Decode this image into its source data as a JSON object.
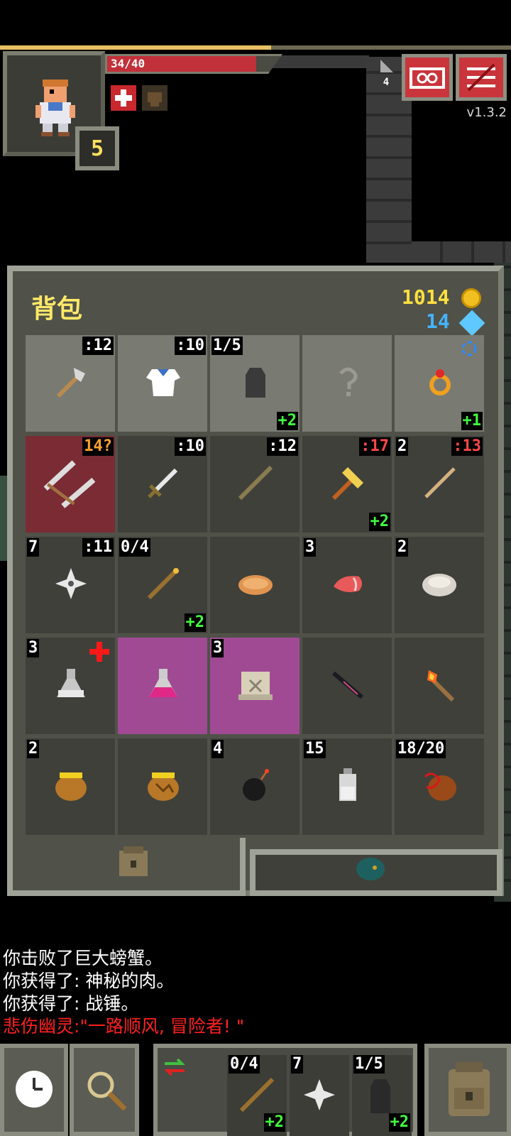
{
  "status": {
    "hp_text": "34/40",
    "hp_fraction": 0.85,
    "hero_level": "5",
    "depth": "4",
    "version": "v1.3.2",
    "xp_fraction": 0.53
  },
  "buttons": {
    "journal_icon": "journal-icon",
    "menu_icon": "menu-icon"
  },
  "backpack": {
    "title": "背包",
    "gold": "1014",
    "energy": "14",
    "slots": [
      {
        "name": "hand-axe",
        "level": ":12",
        "qty": "",
        "upgrade": ""
      },
      {
        "name": "cloth-armor",
        "level": ":10",
        "qty": "",
        "upgrade": ""
      },
      {
        "name": "cloak",
        "level": "",
        "qty": "1/5",
        "upgrade": "+2"
      },
      {
        "name": "empty-misc",
        "level": "",
        "qty": "",
        "upgrade": ""
      },
      {
        "name": "ring",
        "level": "",
        "qty": "",
        "upgrade": "+1"
      },
      {
        "name": "crossbow",
        "level": "14?",
        "qty": "",
        "upgrade": ""
      },
      {
        "name": "sword",
        "level": ":10",
        "qty": "",
        "upgrade": ""
      },
      {
        "name": "quarterstaff",
        "level": ":12",
        "qty": "",
        "upgrade": ""
      },
      {
        "name": "war-hammer",
        "level": ":17",
        "qty": "",
        "upgrade": "+2"
      },
      {
        "name": "darts",
        "level": ":13",
        "qty": "2",
        "upgrade": ""
      },
      {
        "name": "shuriken",
        "level": ":11",
        "qty": "7",
        "upgrade": ""
      },
      {
        "name": "wand",
        "level": "",
        "qty": "0/4",
        "upgrade": "+2"
      },
      {
        "name": "pasty",
        "level": "",
        "qty": "",
        "upgrade": ""
      },
      {
        "name": "mystery-meat",
        "level": "",
        "qty": "3",
        "upgrade": ""
      },
      {
        "name": "stone",
        "level": "",
        "qty": "2",
        "upgrade": ""
      },
      {
        "name": "potion-healing",
        "level": "",
        "qty": "3",
        "upgrade": ""
      },
      {
        "name": "potion-purple",
        "level": "",
        "qty": "",
        "upgrade": ""
      },
      {
        "name": "scroll",
        "level": "",
        "qty": "3",
        "upgrade": ""
      },
      {
        "name": "dagger-dark",
        "level": "",
        "qty": "",
        "upgrade": ""
      },
      {
        "name": "torch",
        "level": "",
        "qty": "",
        "upgrade": ""
      },
      {
        "name": "honey-pot",
        "level": "",
        "qty": "2",
        "upgrade": ""
      },
      {
        "name": "honey-pot-shattered",
        "level": "",
        "qty": "",
        "upgrade": ""
      },
      {
        "name": "bomb",
        "level": "",
        "qty": "4",
        "upgrade": ""
      },
      {
        "name": "dew-vial",
        "level": "",
        "qty": "15",
        "upgrade": ""
      },
      {
        "name": "waterskin",
        "level": "",
        "qty": "18/20",
        "upgrade": ""
      }
    ]
  },
  "log": [
    {
      "text": "你击败了巨大螃蟹。",
      "color": "#ffffff"
    },
    {
      "text": "你获得了: 神秘的肉。",
      "color": "#ffffff"
    },
    {
      "text": "你获得了: 战锤。",
      "color": "#ffffff"
    },
    {
      "text": "悲伤幽灵:\"一路顺风, 冒险者! \"",
      "color": "#ff2020"
    }
  ],
  "quickslots": [
    {
      "qty": "0/4",
      "upgrade": "+2",
      "name": "wand"
    },
    {
      "qty": "7",
      "upgrade": "",
      "name": "shuriken"
    },
    {
      "qty": "1/5",
      "upgrade": "+2",
      "name": "cloak"
    }
  ]
}
